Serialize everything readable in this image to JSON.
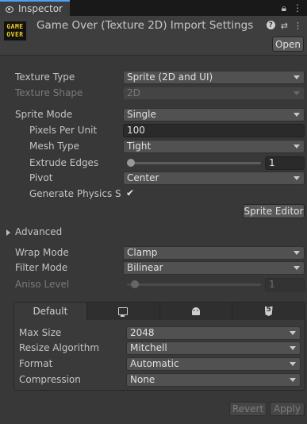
{
  "tab": {
    "label": "Inspector"
  },
  "header": {
    "thumbnail_text": "GAME OVER",
    "title": "Game Over (Texture 2D) Import Settings",
    "open_label": "Open"
  },
  "settings": {
    "texture_type": {
      "label": "Texture Type",
      "value": "Sprite (2D and UI)"
    },
    "texture_shape": {
      "label": "Texture Shape",
      "value": "2D"
    },
    "sprite_mode": {
      "label": "Sprite Mode",
      "value": "Single"
    },
    "pixels_per_unit": {
      "label": "Pixels Per Unit",
      "value": "100"
    },
    "mesh_type": {
      "label": "Mesh Type",
      "value": "Tight"
    },
    "extrude_edges": {
      "label": "Extrude Edges",
      "value": "1",
      "slider_fraction": 0.03
    },
    "pivot": {
      "label": "Pivot",
      "value": "Center"
    },
    "generate_physics_shape": {
      "label": "Generate Physics Sha",
      "checked": true
    },
    "sprite_editor_label": "Sprite Editor",
    "advanced_label": "Advanced",
    "wrap_mode": {
      "label": "Wrap Mode",
      "value": "Clamp"
    },
    "filter_mode": {
      "label": "Filter Mode",
      "value": "Bilinear"
    },
    "aniso_level": {
      "label": "Aniso Level",
      "value": "1",
      "slider_fraction": 0.06
    }
  },
  "platform": {
    "tabs": [
      {
        "label": "Default",
        "icon": ""
      },
      {
        "label": "",
        "icon": "monitor-icon"
      },
      {
        "label": "",
        "icon": "android-icon"
      },
      {
        "label": "",
        "icon": "html5-icon"
      }
    ],
    "max_size": {
      "label": "Max Size",
      "value": "2048"
    },
    "resize_algorithm": {
      "label": "Resize Algorithm",
      "value": "Mitchell"
    },
    "format": {
      "label": "Format",
      "value": "Automatic"
    },
    "compression": {
      "label": "Compression",
      "value": "None"
    }
  },
  "footer": {
    "revert_label": "Revert",
    "apply_label": "Apply"
  },
  "colors": {
    "accent": "#4aa1ff",
    "background": "#383838",
    "tabbar": "#191919"
  }
}
